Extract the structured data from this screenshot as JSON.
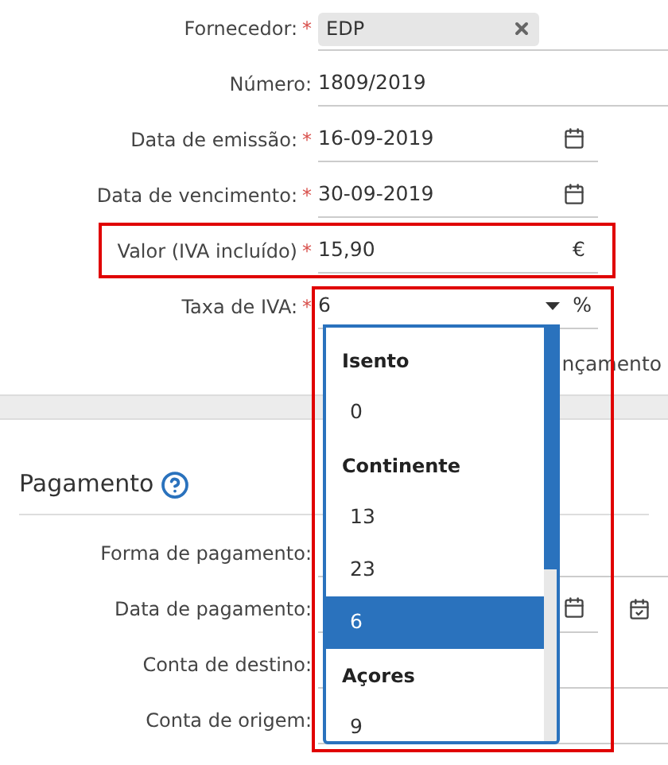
{
  "invoice": {
    "fields": [
      {
        "label": "Fornecedor:",
        "required_mark": "*",
        "kind": "tag",
        "value": "EDP",
        "highlighted": false
      },
      {
        "label": "Número:",
        "kind": "text",
        "value": "1809/2019",
        "highlighted": false
      },
      {
        "label": "Data de emissão:",
        "required_mark": "*",
        "kind": "date",
        "value": "16-09-2019",
        "highlighted": false
      },
      {
        "label": "Data de vencimento:",
        "required_mark": "*",
        "kind": "date",
        "value": "30-09-2019",
        "highlighted": false
      },
      {
        "label": "Valor (IVA incluído)",
        "required_mark": "*",
        "kind": "amount",
        "value": "15,90",
        "unit": "€",
        "highlighted": true
      },
      {
        "label": "Taxa de IVA:",
        "required_mark": "*",
        "kind": "select",
        "value": "6",
        "unit": "%",
        "highlighted": true
      }
    ],
    "partial_text": "nçamento"
  },
  "payment": {
    "title": "Pagamento",
    "fields": [
      {
        "label": "Forma de pagamento:",
        "kind": "select"
      },
      {
        "label": "Data de pagamento:",
        "kind": "date"
      },
      {
        "label": "Conta de destino:",
        "kind": "select"
      },
      {
        "label": "Conta de origem:",
        "kind": "select"
      }
    ]
  },
  "dropdown": {
    "options": [
      {
        "kind": "group",
        "label": "Isento"
      },
      {
        "kind": "option",
        "label": "0",
        "selected": false
      },
      {
        "kind": "group",
        "label": "Continente"
      },
      {
        "kind": "option",
        "label": "13",
        "selected": false
      },
      {
        "kind": "option",
        "label": "23",
        "selected": false
      },
      {
        "kind": "option",
        "label": "6",
        "selected": true
      },
      {
        "kind": "group",
        "label": "Açores"
      },
      {
        "kind": "option",
        "label": "9",
        "selected": false
      }
    ]
  }
}
